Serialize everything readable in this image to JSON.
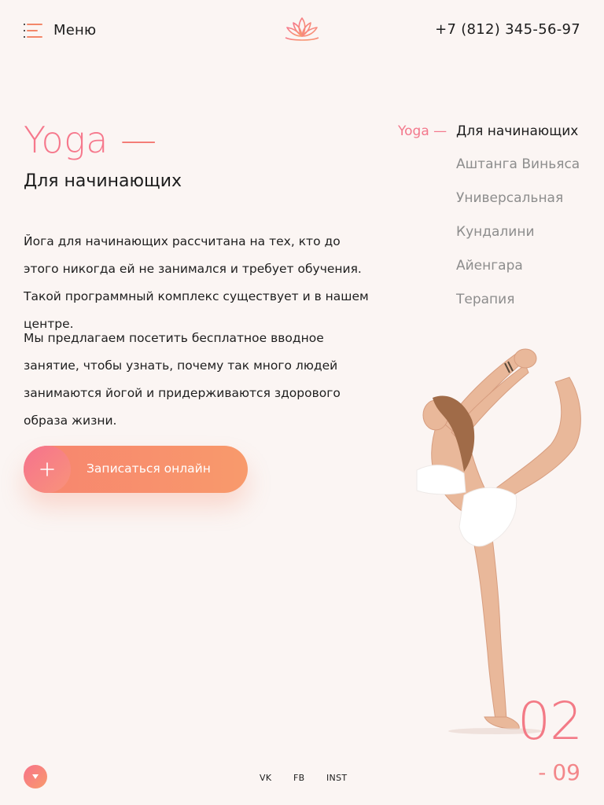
{
  "header": {
    "menu_label": "Меню",
    "phone": "+7 (812) 345-56-97"
  },
  "hero": {
    "title": "Yoga",
    "title_dash": "—",
    "subtitle": "Для начинающих",
    "paragraphs": [
      "Йога для начинающих рассчитана на тех, кто до этого никогда ей не занимался и требует обучения. Такой программный комплекс существует и в нашем центре.",
      "Мы предлагаем посетить бесплатное вводное занятие, чтобы узнать, почему так много людей занимаются йогой и придерживаются здорового образа жизни."
    ],
    "cta_label": "Записаться онлайн"
  },
  "programs": {
    "prefix": "Yoga —",
    "items": [
      {
        "label": "Для начинающих",
        "active": true
      },
      {
        "label": "Аштанга Виньяса",
        "active": false
      },
      {
        "label": "Универсальная",
        "active": false
      },
      {
        "label": "Кундалини",
        "active": false
      },
      {
        "label": "Айенгара",
        "active": false
      },
      {
        "label": "Терапия",
        "active": false
      }
    ]
  },
  "slide_counter": {
    "current": "02",
    "total_dash": "-",
    "total": "09"
  },
  "social": {
    "vk": "VK",
    "fb": "FB",
    "inst": "INST"
  },
  "colors": {
    "accent_pink": "#f6788c",
    "accent_coral": "#f89a6c",
    "background": "#fbf5f3"
  },
  "icons": {
    "menu": "menu-icon",
    "logo": "lotus-logo",
    "cta": "plus-icon",
    "scroll": "chevron-down-icon"
  }
}
